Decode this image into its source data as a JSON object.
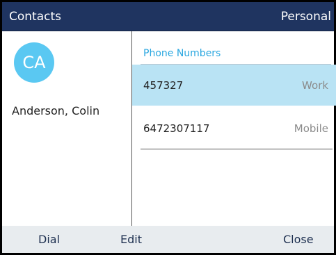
{
  "header": {
    "title": "Contacts",
    "directory": "Personal"
  },
  "contact": {
    "initials": "CA",
    "name": "Anderson, Colin",
    "avatar_color": "#5ac8f2"
  },
  "phones": {
    "section_label": "Phone Numbers",
    "items": [
      {
        "number": "457327",
        "type": "Work",
        "selected": true
      },
      {
        "number": "6472307117",
        "type": "Mobile",
        "selected": false
      }
    ]
  },
  "softkeys": {
    "dial": "Dial",
    "edit": "Edit",
    "close": "Close"
  },
  "colors": {
    "header_bg": "#1f3460",
    "accent": "#2aa7e0",
    "selection": "#b9e3f4"
  }
}
